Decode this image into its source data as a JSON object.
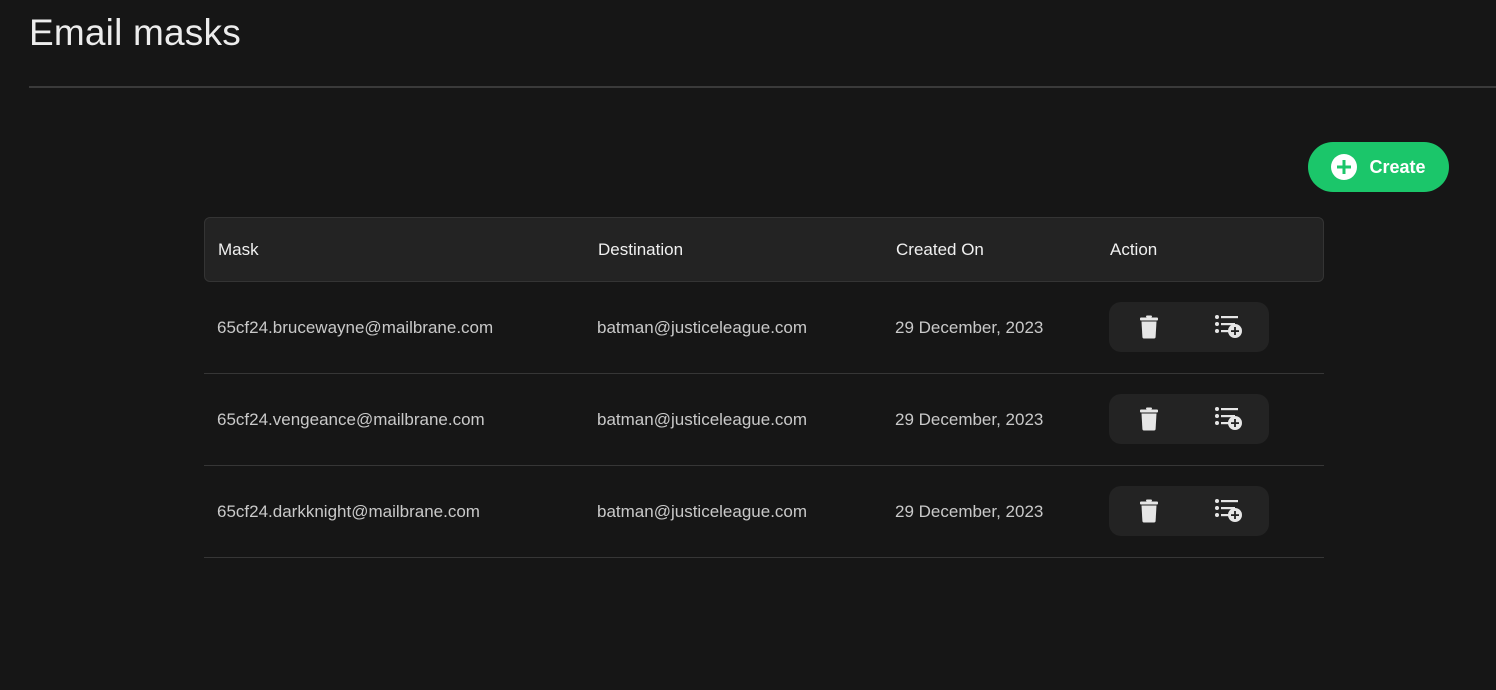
{
  "header": {
    "title": "Email masks"
  },
  "toolbar": {
    "create_label": "Create",
    "create_icon": "plus-circle-icon",
    "accent_color": "#1bc66a"
  },
  "table": {
    "columns": [
      "Mask",
      "Destination",
      "Created On",
      "Action"
    ],
    "rows": [
      {
        "mask": "65cf24.brucewayne@mailbrane.com",
        "destination": "batman@justiceleague.com",
        "created_on": "29 December, 2023",
        "actions": [
          "trash-icon",
          "list-add-icon"
        ]
      },
      {
        "mask": "65cf24.vengeance@mailbrane.com",
        "destination": "batman@justiceleague.com",
        "created_on": "29 December, 2023",
        "actions": [
          "trash-icon",
          "list-add-icon"
        ]
      },
      {
        "mask": "65cf24.darkknight@mailbrane.com",
        "destination": "batman@justiceleague.com",
        "created_on": "29 December, 2023",
        "actions": [
          "trash-icon",
          "list-add-icon"
        ]
      }
    ]
  }
}
